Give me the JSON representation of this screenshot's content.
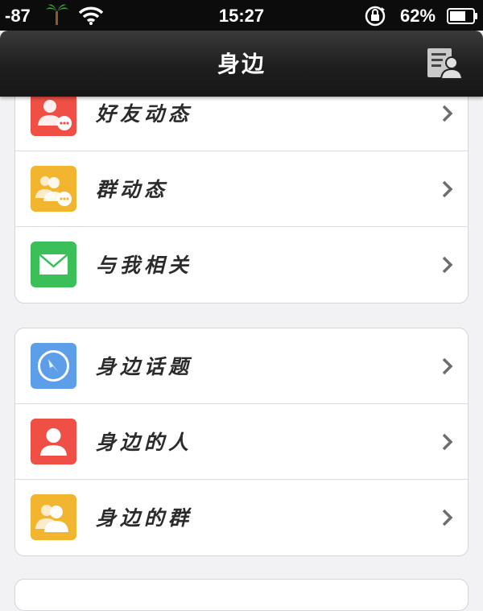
{
  "status_bar": {
    "signal": "-87",
    "time": "15:27",
    "battery": "62%",
    "icons": [
      "palm-tree-icon",
      "wifi-icon",
      "rotation-lock-icon",
      "battery-icon"
    ]
  },
  "nav": {
    "title": "身边",
    "right_icon": "contacts-icon"
  },
  "groups": [
    {
      "items": [
        {
          "label": "好友动态",
          "icon": "friend-feed-icon",
          "color": "#ef4f45"
        },
        {
          "label": "群动态",
          "icon": "group-feed-icon",
          "color": "#f2b530"
        },
        {
          "label": "与我相关",
          "icon": "mail-icon",
          "color": "#3bbf59"
        }
      ]
    },
    {
      "items": [
        {
          "label": "身边话题",
          "icon": "compass-icon",
          "color": "#5c9fe8"
        },
        {
          "label": "身边的人",
          "icon": "person-icon",
          "color": "#ef4f45"
        },
        {
          "label": "身边的群",
          "icon": "group-icon",
          "color": "#f2b530"
        }
      ]
    }
  ]
}
